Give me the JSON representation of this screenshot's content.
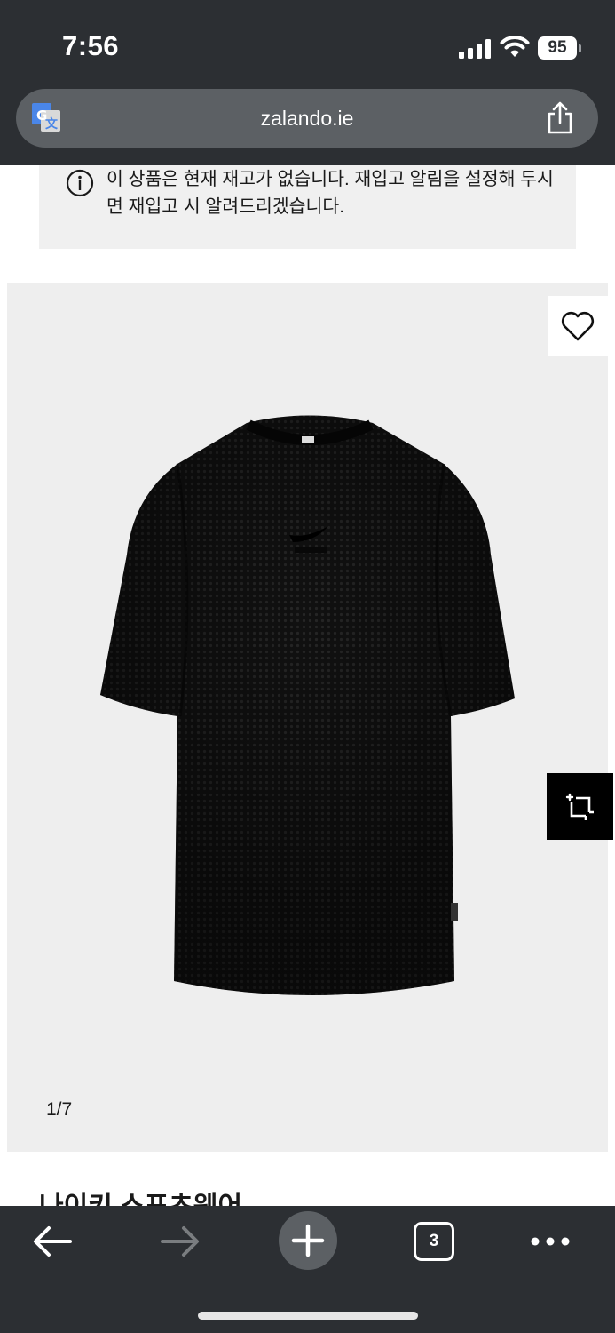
{
  "status_bar": {
    "time": "7:56",
    "battery": "95"
  },
  "browser": {
    "url": "zalando.ie",
    "translate_icon": "translate-icon",
    "share_icon": "share-icon",
    "open_tabs": "3"
  },
  "notice": {
    "icon": "info-icon",
    "text": "이 상품은 현재 재고가 없습니다. 재입고 알림을 설정해 두시면 재입고 시 알려드리겠습니다."
  },
  "product": {
    "image_alt": "black mesh t-shirt",
    "pager": "1/7",
    "title_partial": "나이키 스포츠웨어"
  },
  "colors": {
    "chrome": "#2c2f33",
    "url_bar": "#5c6064",
    "notice_bg": "#f0f0f0",
    "product_bg": "#eeeeee"
  }
}
